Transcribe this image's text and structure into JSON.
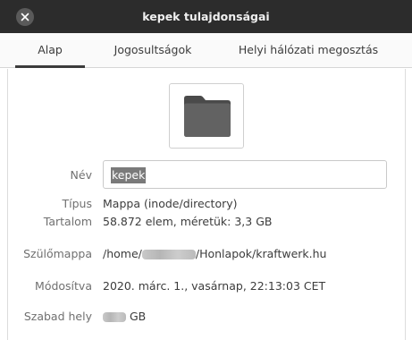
{
  "window": {
    "title": "kepek tulajdonságai",
    "close_icon": "close-icon"
  },
  "tabs": [
    {
      "label": "Alap",
      "active": true
    },
    {
      "label": "Jogosultságok",
      "active": false
    },
    {
      "label": "Helyi hálózati megosztás",
      "active": false
    }
  ],
  "main": {
    "icon": "folder-icon",
    "name": {
      "label": "Név",
      "value": "kepek"
    },
    "type": {
      "label": "Típus",
      "value": "Mappa (inode/directory)"
    },
    "contents": {
      "label": "Tartalom",
      "value": "58.872 elem, méretük: 3,3 GB"
    },
    "parent": {
      "label": "Szülőmappa",
      "value_prefix": "/home/",
      "value_suffix": "/Honlapok/kraftwerk.hu"
    },
    "modified": {
      "label": "Módosítva",
      "value": "2020. márc. 1., vasárnap, 22:13:03 CET"
    },
    "free_space": {
      "label": "Szabad hely",
      "value_suffix": "GB"
    }
  },
  "colors": {
    "titlebar": "#2c2c2c",
    "selection": "#7a7a7a",
    "folder": "#5e5e5e"
  }
}
